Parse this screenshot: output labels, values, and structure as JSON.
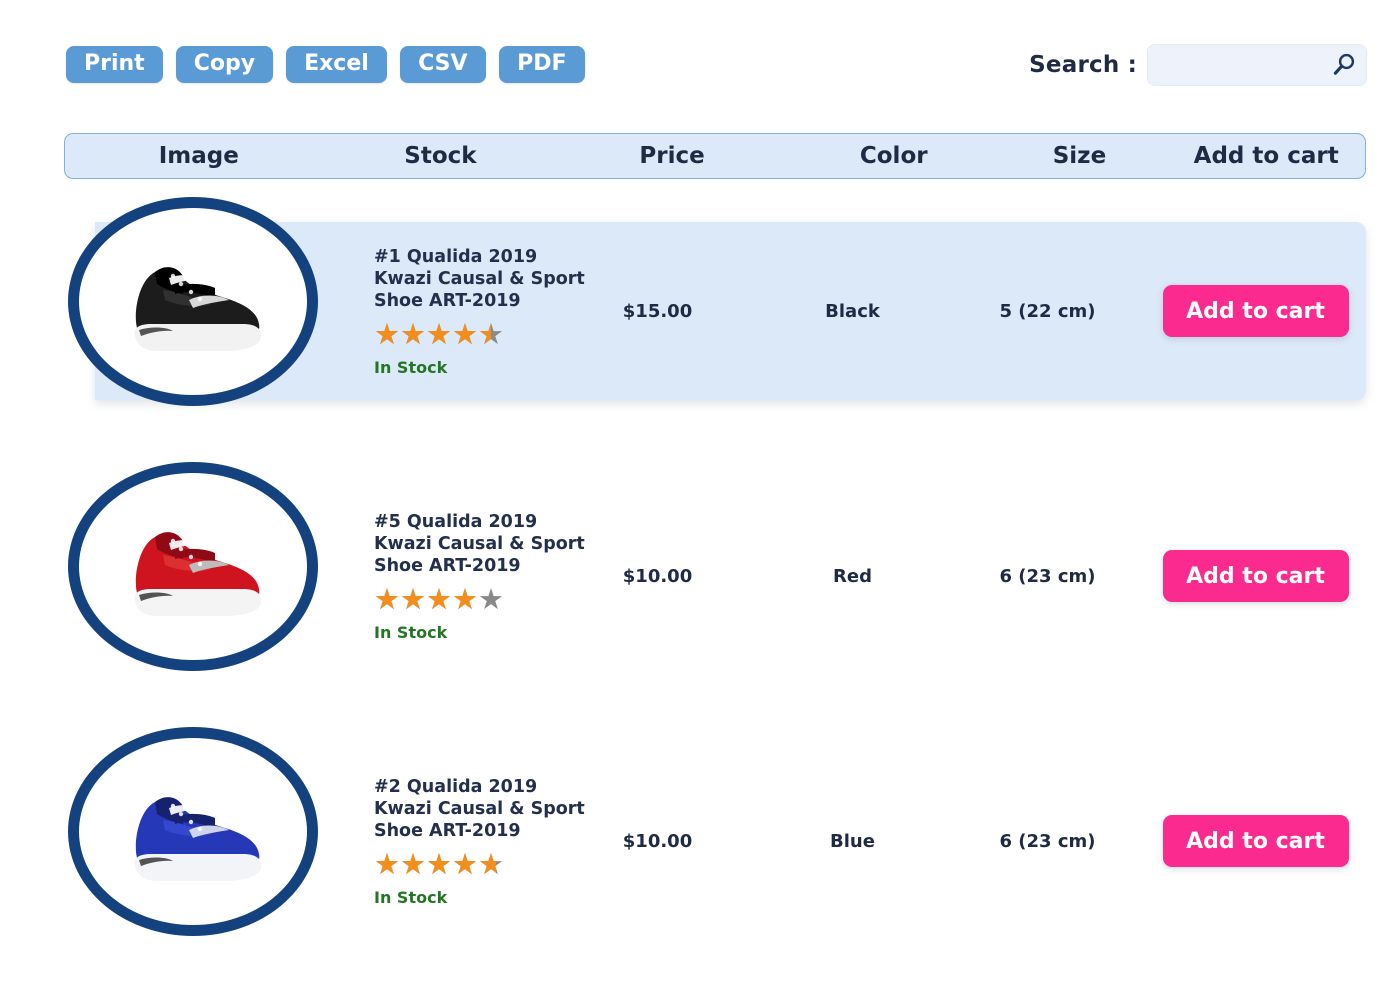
{
  "toolbar": {
    "buttons": [
      {
        "label": "Print",
        "name": "print-button"
      },
      {
        "label": "Copy",
        "name": "copy-button"
      },
      {
        "label": "Excel",
        "name": "excel-button"
      },
      {
        "label": "CSV",
        "name": "csv-button"
      },
      {
        "label": "PDF",
        "name": "pdf-button"
      }
    ],
    "button_color": "#5b9bd5"
  },
  "search": {
    "label": "Search :",
    "value": "",
    "placeholder": "",
    "icon": "search-icon"
  },
  "table": {
    "headers": {
      "image": "Image",
      "stock": "Stock",
      "price": "Price",
      "color": "Color",
      "size": "Size",
      "cart": "Add to cart"
    },
    "header_bg": "#dbe9f9",
    "highlight_bg": "#dce9f8",
    "rows": [
      {
        "title": "#1 Qualida 2019\nKwazi Causal & Sport\nShoe ART-2019",
        "rating": 4.5,
        "availability": "In Stock",
        "price": "$15.00",
        "color": "Black",
        "size": "5  (22 cm)",
        "cart_label": "Add to cart",
        "image": "black-sneaker",
        "highlighted": true
      },
      {
        "title": "#5 Qualida 2019\nKwazi Causal & Sport\nShoe ART-2019",
        "rating": 4.0,
        "availability": "In Stock",
        "price": "$10.00",
        "color": "Red",
        "size": "6  (23 cm)",
        "cart_label": "Add to cart",
        "image": "red-sneaker",
        "highlighted": false
      },
      {
        "title": "#2 Qualida 2019\nKwazi Causal & Sport\nShoe ART-2019",
        "rating": 4.7,
        "availability": "In Stock",
        "price": "$10.00",
        "color": "Blue",
        "size": "6  (23 cm)",
        "cart_label": "Add to cart",
        "image": "blue-sneaker",
        "highlighted": false
      }
    ]
  },
  "colors": {
    "accent_pink": "#fa2a8e",
    "ring_navy": "#13427f",
    "star_filled": "#f28e1c",
    "star_empty": "#8a8a8a",
    "in_stock_green": "#247524"
  }
}
